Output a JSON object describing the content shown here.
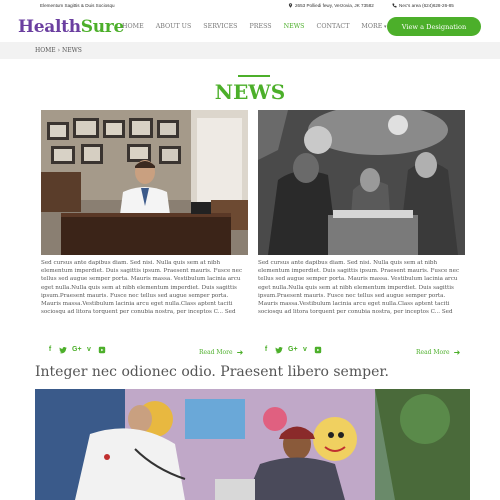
{
  "topbar": {
    "tagline": "Elementum Sagittis & Duis Sociosqu",
    "address": "2653 Polliedi fewy, Verzovia, JK 73582",
    "phone": "Nec's area (624)628-26-85",
    "address_icon": "location-pin-icon",
    "phone_icon": "phone-icon"
  },
  "logo": {
    "part1": "Health",
    "part2": "Sure"
  },
  "nav": {
    "items": [
      "HOME",
      "ABOUT US",
      "SERVICES",
      "PRESS",
      "NEWS",
      "CONTACT",
      "MORE"
    ],
    "active": "NEWS"
  },
  "cta": {
    "label": "View a Designation"
  },
  "breadcrumb": {
    "home": "HOME",
    "separator": "›",
    "current": "NEWS"
  },
  "page": {
    "title": "NEWS"
  },
  "cards": [
    {
      "excerpt": "Sed cursus ante dapibus diam. Sed nisi. Nulla quis sem at nibh elementum imperdiet. Duis sagittis ipsum. Praesent mauris. Fusce nec tellus sed augue semper porta. Mauris massa. Vestibulum lacinia arcu eget nulla.Nulla quis sem at nibh elementum imperdiet. Duis sagittis ipsum.Praesent mauris. Fusce nec tellus sed augue semper porta. Mauris massa.Vestibulum lacinia arcu eget nulla.Class aptent taciti sociosqu ad litora torquent per conubia nostra, per inceptos C... Sed",
      "read_more": "Read More",
      "social_icons": [
        "facebook-icon",
        "twitter-icon",
        "google-plus-icon",
        "vimeo-icon",
        "youtube-icon"
      ]
    },
    {
      "excerpt": "Sed cursus ante dapibus diam. Sed nisi. Nulla quis sem at nibh elementum imperdiet. Duis sagittis ipsum. Praesent mauris. Fusce nec tellus sed augue semper porta. Mauris massa. Vestibulum lacinia arcu eget nulla.Nulla quis sem at nibh elementum imperdiet. Duis sagittis ipsum.Praesent mauris. Fusce nec tellus sed augue semper porta. Mauris massa.Vestibulum lacinia arcu eget nulla.Class aptent taciti sociosqu ad litora torquent per conubia nostra, per inceptos C... Sed",
      "read_more": "Read More",
      "social_icons": [
        "facebook-icon",
        "twitter-icon",
        "google-plus-icon",
        "vimeo-icon",
        "youtube-icon"
      ]
    }
  ],
  "feature": {
    "headline": "Integer nec odionec odio. Praesent libero semper."
  },
  "colors": {
    "brand_purple": "#6b3fa0",
    "brand_green": "#4caf2a",
    "breadcrumb_bg": "#f2f2f2"
  }
}
